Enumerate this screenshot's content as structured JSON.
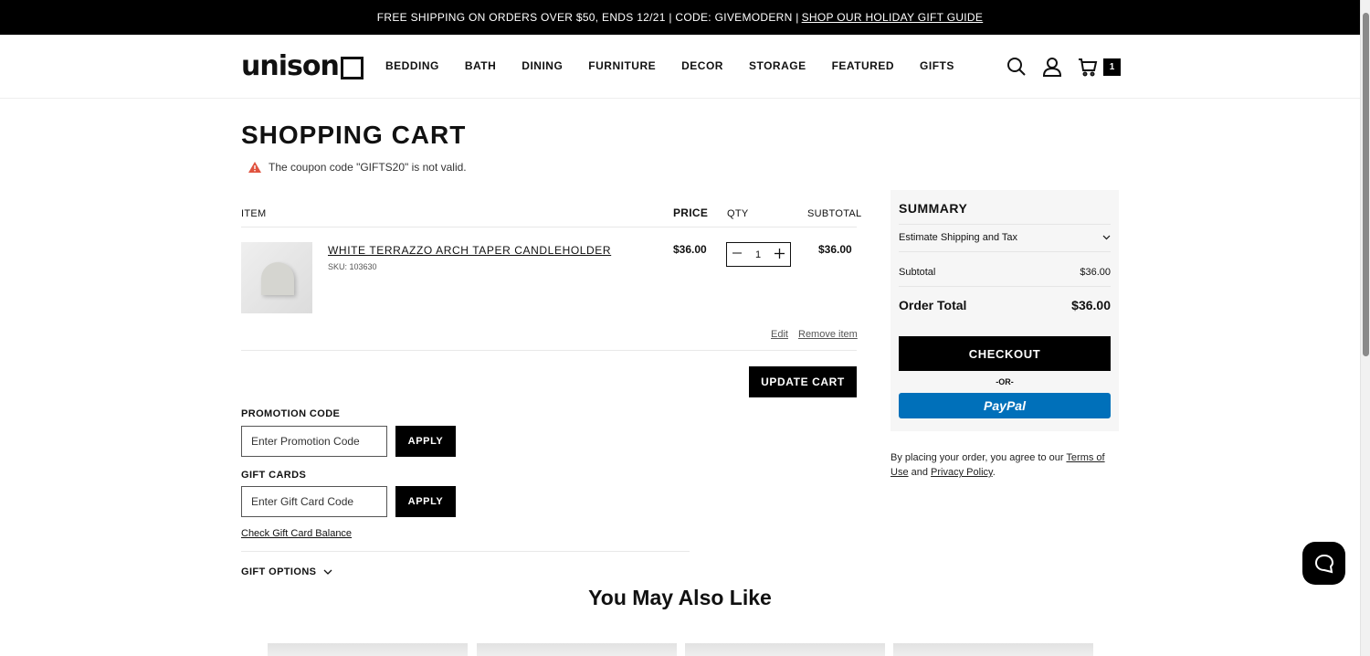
{
  "promo": {
    "text": "FREE SHIPPING ON ORDERS OVER $50, ENDS 12/21 | CODE: GIVEMODERN |",
    "link": "SHOP OUR HOLIDAY GIFT GUIDE"
  },
  "header": {
    "logo": "unison",
    "nav": [
      "BEDDING",
      "BATH",
      "DINING",
      "FURNITURE",
      "DECOR",
      "STORAGE",
      "FEATURED",
      "GIFTS"
    ],
    "cart_count": "1",
    "icons": [
      "search-icon",
      "account-icon",
      "cart-icon"
    ]
  },
  "cart": {
    "title": "SHOPPING CART",
    "alert": "The coupon code \"GIFTS20\" is not valid.",
    "columns": {
      "item": "ITEM",
      "price": "PRICE",
      "qty": "QTY",
      "subtotal": "SUBTOTAL"
    },
    "items": [
      {
        "name": "WHITE TERRAZZO ARCH TAPER CANDLEHOLDER",
        "sku": "SKU: 103630",
        "price": "$36.00",
        "qty": "1",
        "subtotal": "$36.00"
      }
    ],
    "edit_label": "Edit",
    "remove_label": "Remove item",
    "update_label": "UPDATE CART"
  },
  "promotion": {
    "label": "PROMOTION CODE",
    "placeholder": "Enter Promotion Code",
    "apply": "APPLY"
  },
  "gift_cards": {
    "label": "GIFT CARDS",
    "placeholder": "Enter Gift Card Code",
    "apply": "APPLY",
    "check_balance": "Check Gift Card Balance"
  },
  "gift_options": "GIFT OPTIONS",
  "recommendations": {
    "title": "You May Also Like"
  },
  "summary": {
    "title": "SUMMARY",
    "estimate": "Estimate Shipping and Tax",
    "subtotal_label": "Subtotal",
    "subtotal_value": "$36.00",
    "total_label": "Order Total",
    "total_value": "$36.00",
    "checkout": "CHECKOUT",
    "or": "-OR-",
    "paypal": "PayPal"
  },
  "terms": {
    "prefix": "By placing your order, you agree to our",
    "terms_link": "Terms of Use",
    "and": "and",
    "privacy_link": "Privacy Policy",
    "suffix": "."
  },
  "colors": {
    "accent": "#000000",
    "paypal": "#0070ba",
    "alert": "#e0533f"
  }
}
